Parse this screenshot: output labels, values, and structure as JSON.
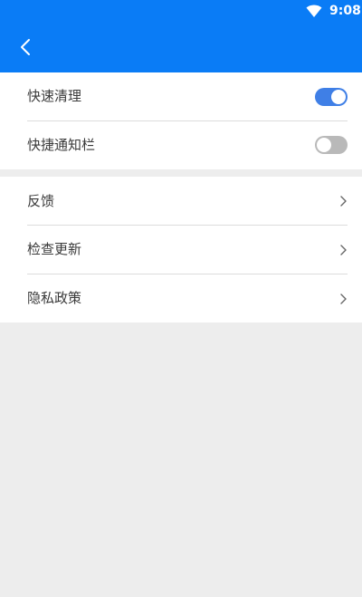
{
  "status_bar": {
    "time": "9:08",
    "wifi_icon": "wifi-icon"
  },
  "app_bar": {
    "back_icon": "chevron-left-icon"
  },
  "settings": {
    "toggles": [
      {
        "label": "快速清理",
        "enabled": true
      },
      {
        "label": "快捷通知栏",
        "enabled": false
      }
    ],
    "links": [
      {
        "label": "反馈",
        "icon": "chevron-right-icon"
      },
      {
        "label": "检查更新",
        "icon": "chevron-right-icon"
      },
      {
        "label": "隐私政策",
        "icon": "chevron-right-icon"
      }
    ]
  },
  "colors": {
    "app_bar": "#0a7cf6",
    "toggle_on": "#3f7fe6",
    "toggle_off": "#b9b9b9",
    "background": "#ededed"
  }
}
